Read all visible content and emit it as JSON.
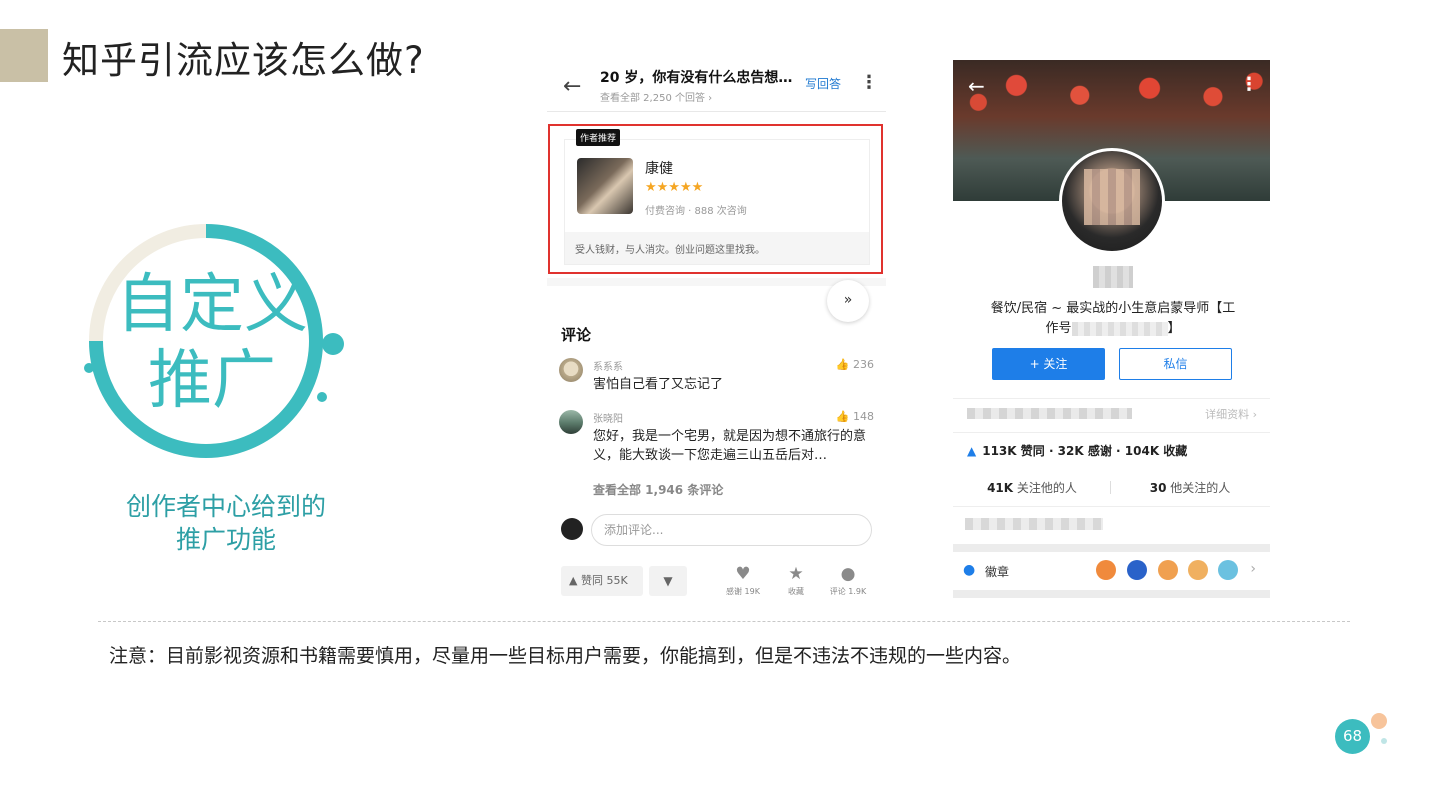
{
  "slide": {
    "title": "知乎引流应该怎么做?",
    "ring_text_line1": "自定义",
    "ring_text_line2": "推广",
    "caption_line1": "创作者中心给到的",
    "caption_line2": "推广功能",
    "note": "注意：目前影视资源和书籍需要慎用，尽量用一些目标用户需要，你能搞到，但是不违法不违规的一些内容。",
    "page_number": "68",
    "colors": {
      "accent": "#3cbcbf",
      "title_block": "#c9c0a6",
      "ring_light": "#f1ede2",
      "dot_orange": "#f7c49b"
    }
  },
  "question_screen": {
    "back_icon": "arrow-left-icon",
    "question_title": "20 岁，你有没有什么忠告想…",
    "answers_link": "查看全部 2,250 个回答 ›",
    "write_answer": "写回答",
    "more_icon": "more-vertical-icon",
    "card": {
      "tag": "作者推荐",
      "name": "康健",
      "stars": "★★★★★",
      "meta": "付费咨询 · 888 次咨询",
      "slogan": "受人钱财，与人消灾。创业问题这里找我。"
    },
    "collapse_icon": "chevrons-down-icon",
    "comments_title": "评论",
    "comments": [
      {
        "user": "系系系",
        "likes": "236",
        "text": "害怕自己看了又忘记了"
      },
      {
        "user": "张晓阳",
        "likes": "148",
        "text": "您好，我是一个宅男，就是因为想不通旅行的意义，能大致谈一下您走遍三山五岳后对…"
      }
    ],
    "view_all_comments": "查看全部 1,946 条评论",
    "add_comment_placeholder": "添加评论...",
    "bottom": {
      "upvote": "▲  赞同 55K",
      "downvote": "▼",
      "thanks": "感谢 19K",
      "collect": "收藏",
      "comment": "评论 1.9K"
    }
  },
  "profile_screen": {
    "back_icon": "arrow-left-icon",
    "more_icon": "more-vertical-icon",
    "headline_part1": "餐饮/民宿 ~ 最实战的小生意启蒙导师【工",
    "headline_part2": "作号",
    "headline_end": "】",
    "follow_button": "+ 关注",
    "message_button": "私信",
    "detail_link": "详细资料 ›",
    "stats": "113K 赞同 · 32K 感谢 · 104K 收藏",
    "following_count": "41K",
    "following_label": "关注他的人",
    "followers_count": "30",
    "followers_label": "他关注的人",
    "badges_label": "徽章",
    "badge_colors": [
      "#f08a3c",
      "#2a62c9",
      "#f0a050",
      "#f0b060",
      "#6bc1e0"
    ]
  }
}
